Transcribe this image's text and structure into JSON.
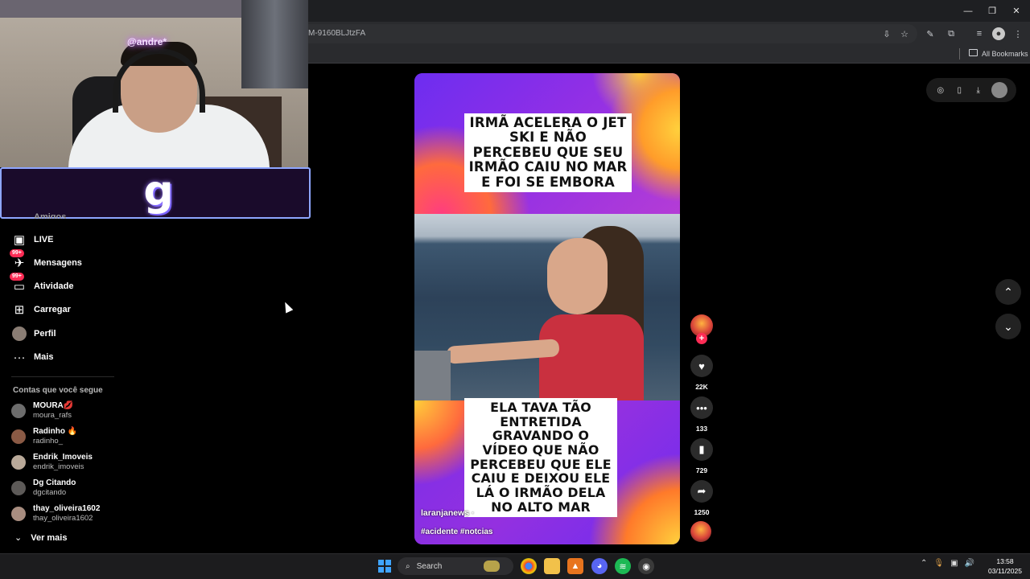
{
  "browser": {
    "url": "M-9160BLJtzFA",
    "bookmarks_label": "All Bookmarks",
    "window_controls": [
      "minimize-icon",
      "restore-icon",
      "close-icon"
    ]
  },
  "stream_overlay": {
    "neon_sign": "@andre*",
    "logo": "g"
  },
  "sidebar": {
    "cut_item": "Amigos",
    "items": [
      {
        "label": "LIVE",
        "icon": "live-tv-icon"
      },
      {
        "label": "Mensagens",
        "icon": "messages-icon",
        "badge": "99+"
      },
      {
        "label": "Atividade",
        "icon": "activity-icon",
        "badge": "99+"
      },
      {
        "label": "Carregar",
        "icon": "upload-icon"
      },
      {
        "label": "Perfil",
        "icon": "profile-avatar"
      },
      {
        "label": "Mais",
        "icon": "more-icon"
      }
    ],
    "following_title": "Contas que você segue",
    "accounts": [
      {
        "name": "MOURA💋",
        "username": "moura_rafs"
      },
      {
        "name": "Radinho 🔥",
        "username": "radinho_"
      },
      {
        "name": "Endrik_Imoveis",
        "username": "endrik_imoveis"
      },
      {
        "name": "Dg Citando",
        "username": "dgcitando"
      },
      {
        "name": "thay_oliveira1602",
        "username": "thay_oliveira1602"
      }
    ],
    "see_more": "Ver mais"
  },
  "video": {
    "caption_top": "IRMÃ ACELERA O JET SKI E NÃO PERCEBEU QUE SEU IRMÃO CAIU NO MAR E FOI SE EMBORA",
    "caption_bottom": "ELA TAVA TÃO ENTRETIDA GRAVANDO O VÍDEO QUE NÃO PERCEBEU QUE ELE CAIU E DEIXOU ELE LÁ O IRMÃO DELA NO ALTO MAR",
    "author": "laranjanews · ",
    "tags": "#acidente #notcias",
    "likes": "22K",
    "comments": "133",
    "saves": "729",
    "shares": "1250"
  },
  "taskbar": {
    "search_label": "Search",
    "time": "13:58",
    "date": "03/11/2025"
  },
  "colors": {
    "tiktok_red": "#fe2c55",
    "overlay_border": "#8ea6ff",
    "windows_blue": "#3fa4ff"
  }
}
